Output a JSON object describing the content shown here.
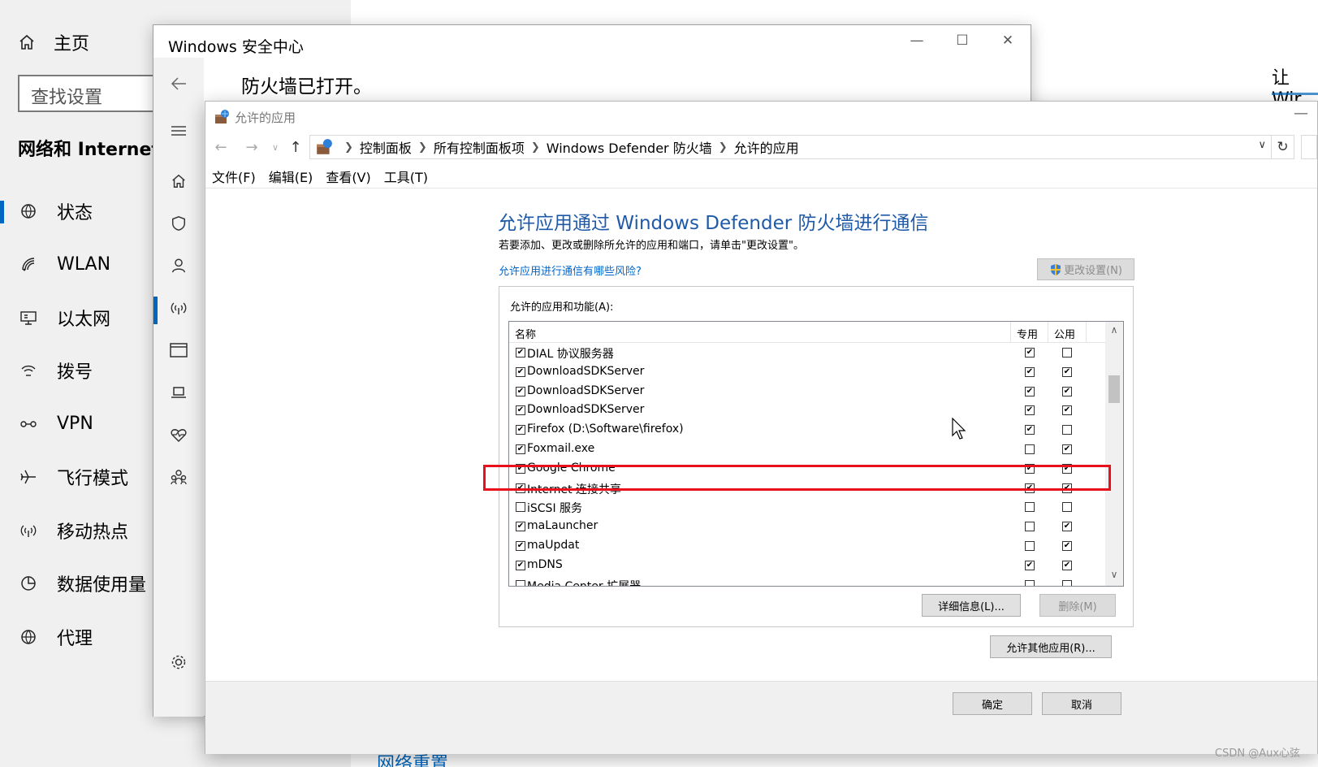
{
  "settings": {
    "home_label": "主页",
    "search_placeholder": "查找设置",
    "section_title": "网络和 Internet",
    "nav_items": [
      {
        "label": "状态",
        "icon": "globe-status-icon"
      },
      {
        "label": "WLAN",
        "icon": "wifi-icon"
      },
      {
        "label": "以太网",
        "icon": "ethernet-icon"
      },
      {
        "label": "拨号",
        "icon": "dialup-icon"
      },
      {
        "label": "VPN",
        "icon": "vpn-icon"
      },
      {
        "label": "飞行模式",
        "icon": "airplane-icon"
      },
      {
        "label": "移动热点",
        "icon": "hotspot-icon"
      },
      {
        "label": "数据使用量",
        "icon": "data-usage-icon"
      },
      {
        "label": "代理",
        "icon": "proxy-globe-icon"
      }
    ],
    "active_item": "状态",
    "right_hint": "让 Wir",
    "bottom_link": "网络重置"
  },
  "security": {
    "title": "Windows 安全中心",
    "heading": "防火墙已打开。"
  },
  "cpl": {
    "title": "允许的应用",
    "breadcrumb": [
      "控制面板",
      "所有控制面板项",
      "Windows Defender 防火墙",
      "允许的应用"
    ],
    "menu": [
      "文件(F)",
      "编辑(E)",
      "查看(V)",
      "工具(T)"
    ],
    "page_title": "允许应用通过 Windows Defender 防火墙进行通信",
    "page_desc": "若要添加、更改或删除所允许的应用和端口，请单击\"更改设置\"。",
    "risk_link": "允许应用进行通信有哪些风险?",
    "change_settings": "更改设置(N)",
    "group_label": "允许的应用和功能(A):",
    "columns": {
      "name": "名称",
      "private": "专用",
      "public": "公用"
    },
    "rows": [
      {
        "name": "DIAL 协议服务器",
        "enabled": true,
        "private": true,
        "public": false
      },
      {
        "name": "DownloadSDKServer",
        "enabled": true,
        "private": true,
        "public": true
      },
      {
        "name": "DownloadSDKServer",
        "enabled": true,
        "private": true,
        "public": true
      },
      {
        "name": "DownloadSDKServer",
        "enabled": true,
        "private": true,
        "public": true
      },
      {
        "name": "Firefox (D:\\Software\\firefox)",
        "enabled": true,
        "private": true,
        "public": false
      },
      {
        "name": "Foxmail.exe",
        "enabled": true,
        "private": false,
        "public": true
      },
      {
        "name": "Google Chrome",
        "enabled": true,
        "private": true,
        "public": true
      },
      {
        "name": "Internet 连接共享",
        "enabled": true,
        "private": true,
        "public": true
      },
      {
        "name": "iSCSI 服务",
        "enabled": false,
        "private": false,
        "public": false
      },
      {
        "name": "maLauncher",
        "enabled": true,
        "private": false,
        "public": true
      },
      {
        "name": "maUpdat",
        "enabled": true,
        "private": false,
        "public": true
      },
      {
        "name": "mDNS",
        "enabled": true,
        "private": true,
        "public": true
      },
      {
        "name": "Media Center 扩展器",
        "enabled": false,
        "private": false,
        "public": false
      }
    ],
    "details_btn": "详细信息(L)...",
    "delete_btn": "删除(M)",
    "allow_other_btn": "允许其他应用(R)...",
    "ok_btn": "确定",
    "cancel_btn": "取消"
  },
  "highlighted_row": "Google Chrome",
  "highlight_color": "#e8101a",
  "accent_color": "#0067c0",
  "watermark": "CSDN @Aux心弦"
}
